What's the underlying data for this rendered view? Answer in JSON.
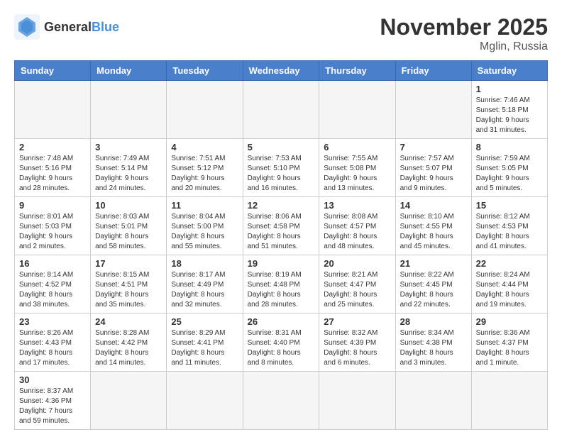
{
  "header": {
    "logo_general": "General",
    "logo_blue": "Blue",
    "month_title": "November 2025",
    "location": "Mglin, Russia"
  },
  "weekdays": [
    "Sunday",
    "Monday",
    "Tuesday",
    "Wednesday",
    "Thursday",
    "Friday",
    "Saturday"
  ],
  "weeks": [
    [
      {
        "day": "",
        "info": ""
      },
      {
        "day": "",
        "info": ""
      },
      {
        "day": "",
        "info": ""
      },
      {
        "day": "",
        "info": ""
      },
      {
        "day": "",
        "info": ""
      },
      {
        "day": "",
        "info": ""
      },
      {
        "day": "1",
        "info": "Sunrise: 7:46 AM\nSunset: 5:18 PM\nDaylight: 9 hours\nand 31 minutes."
      }
    ],
    [
      {
        "day": "2",
        "info": "Sunrise: 7:48 AM\nSunset: 5:16 PM\nDaylight: 9 hours\nand 28 minutes."
      },
      {
        "day": "3",
        "info": "Sunrise: 7:49 AM\nSunset: 5:14 PM\nDaylight: 9 hours\nand 24 minutes."
      },
      {
        "day": "4",
        "info": "Sunrise: 7:51 AM\nSunset: 5:12 PM\nDaylight: 9 hours\nand 20 minutes."
      },
      {
        "day": "5",
        "info": "Sunrise: 7:53 AM\nSunset: 5:10 PM\nDaylight: 9 hours\nand 16 minutes."
      },
      {
        "day": "6",
        "info": "Sunrise: 7:55 AM\nSunset: 5:08 PM\nDaylight: 9 hours\nand 13 minutes."
      },
      {
        "day": "7",
        "info": "Sunrise: 7:57 AM\nSunset: 5:07 PM\nDaylight: 9 hours\nand 9 minutes."
      },
      {
        "day": "8",
        "info": "Sunrise: 7:59 AM\nSunset: 5:05 PM\nDaylight: 9 hours\nand 5 minutes."
      }
    ],
    [
      {
        "day": "9",
        "info": "Sunrise: 8:01 AM\nSunset: 5:03 PM\nDaylight: 9 hours\nand 2 minutes."
      },
      {
        "day": "10",
        "info": "Sunrise: 8:03 AM\nSunset: 5:01 PM\nDaylight: 8 hours\nand 58 minutes."
      },
      {
        "day": "11",
        "info": "Sunrise: 8:04 AM\nSunset: 5:00 PM\nDaylight: 8 hours\nand 55 minutes."
      },
      {
        "day": "12",
        "info": "Sunrise: 8:06 AM\nSunset: 4:58 PM\nDaylight: 8 hours\nand 51 minutes."
      },
      {
        "day": "13",
        "info": "Sunrise: 8:08 AM\nSunset: 4:57 PM\nDaylight: 8 hours\nand 48 minutes."
      },
      {
        "day": "14",
        "info": "Sunrise: 8:10 AM\nSunset: 4:55 PM\nDaylight: 8 hours\nand 45 minutes."
      },
      {
        "day": "15",
        "info": "Sunrise: 8:12 AM\nSunset: 4:53 PM\nDaylight: 8 hours\nand 41 minutes."
      }
    ],
    [
      {
        "day": "16",
        "info": "Sunrise: 8:14 AM\nSunset: 4:52 PM\nDaylight: 8 hours\nand 38 minutes."
      },
      {
        "day": "17",
        "info": "Sunrise: 8:15 AM\nSunset: 4:51 PM\nDaylight: 8 hours\nand 35 minutes."
      },
      {
        "day": "18",
        "info": "Sunrise: 8:17 AM\nSunset: 4:49 PM\nDaylight: 8 hours\nand 32 minutes."
      },
      {
        "day": "19",
        "info": "Sunrise: 8:19 AM\nSunset: 4:48 PM\nDaylight: 8 hours\nand 28 minutes."
      },
      {
        "day": "20",
        "info": "Sunrise: 8:21 AM\nSunset: 4:47 PM\nDaylight: 8 hours\nand 25 minutes."
      },
      {
        "day": "21",
        "info": "Sunrise: 8:22 AM\nSunset: 4:45 PM\nDaylight: 8 hours\nand 22 minutes."
      },
      {
        "day": "22",
        "info": "Sunrise: 8:24 AM\nSunset: 4:44 PM\nDaylight: 8 hours\nand 19 minutes."
      }
    ],
    [
      {
        "day": "23",
        "info": "Sunrise: 8:26 AM\nSunset: 4:43 PM\nDaylight: 8 hours\nand 17 minutes."
      },
      {
        "day": "24",
        "info": "Sunrise: 8:28 AM\nSunset: 4:42 PM\nDaylight: 8 hours\nand 14 minutes."
      },
      {
        "day": "25",
        "info": "Sunrise: 8:29 AM\nSunset: 4:41 PM\nDaylight: 8 hours\nand 11 minutes."
      },
      {
        "day": "26",
        "info": "Sunrise: 8:31 AM\nSunset: 4:40 PM\nDaylight: 8 hours\nand 8 minutes."
      },
      {
        "day": "27",
        "info": "Sunrise: 8:32 AM\nSunset: 4:39 PM\nDaylight: 8 hours\nand 6 minutes."
      },
      {
        "day": "28",
        "info": "Sunrise: 8:34 AM\nSunset: 4:38 PM\nDaylight: 8 hours\nand 3 minutes."
      },
      {
        "day": "29",
        "info": "Sunrise: 8:36 AM\nSunset: 4:37 PM\nDaylight: 8 hours\nand 1 minute."
      }
    ],
    [
      {
        "day": "30",
        "info": "Sunrise: 8:37 AM\nSunset: 4:36 PM\nDaylight: 7 hours\nand 59 minutes."
      },
      {
        "day": "",
        "info": ""
      },
      {
        "day": "",
        "info": ""
      },
      {
        "day": "",
        "info": ""
      },
      {
        "day": "",
        "info": ""
      },
      {
        "day": "",
        "info": ""
      },
      {
        "day": "",
        "info": ""
      }
    ]
  ]
}
